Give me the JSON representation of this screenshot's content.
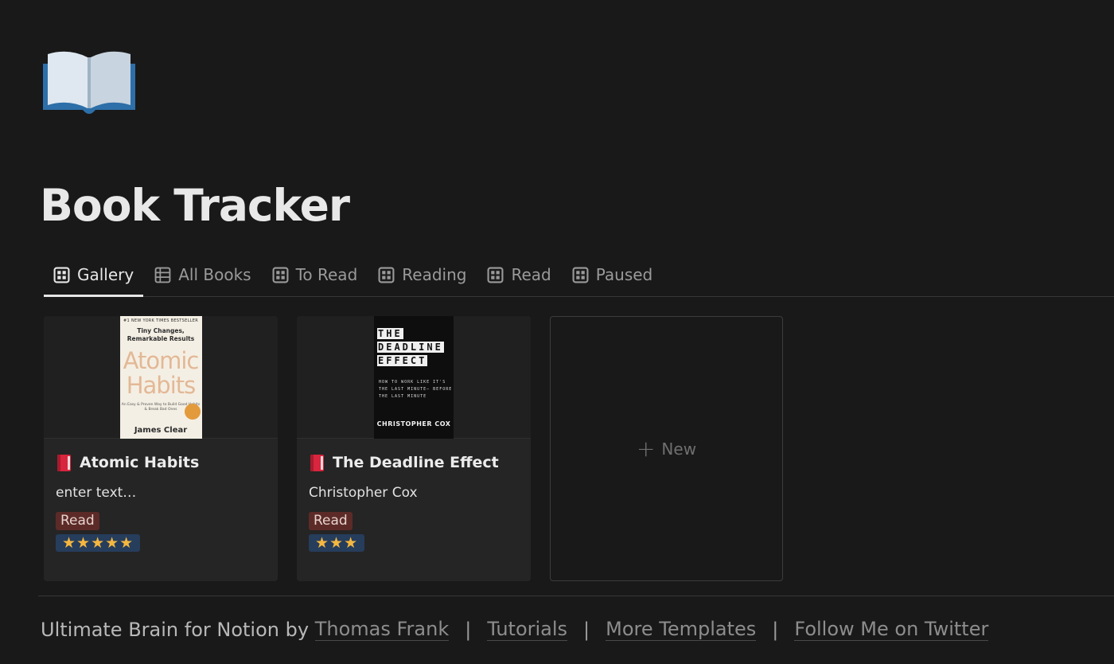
{
  "page": {
    "title": "Book Tracker",
    "icon": "open-book-icon"
  },
  "tabs": [
    {
      "label": "Gallery",
      "icon": "gallery-icon",
      "active": true
    },
    {
      "label": "All Books",
      "icon": "table-icon",
      "active": false
    },
    {
      "label": "To Read",
      "icon": "gallery-icon",
      "active": false
    },
    {
      "label": "Reading",
      "icon": "gallery-icon",
      "active": false
    },
    {
      "label": "Read",
      "icon": "gallery-icon",
      "active": false
    },
    {
      "label": "Paused",
      "icon": "gallery-icon",
      "active": false
    }
  ],
  "cards": [
    {
      "title": "Atomic Habits",
      "author": "enter text…",
      "status": "Read",
      "rating": "★★★★★",
      "cover": {
        "banner": "#1 NEW YORK TIMES BESTSELLER",
        "subtitle": "Tiny Changes, Remarkable Results",
        "title": "Atomic Habits",
        "description": "An Easy & Proven Way to Build Good Habits & Break Bad Ones",
        "author": "James Clear"
      }
    },
    {
      "title": "The Deadline Effect",
      "author": "Christopher Cox",
      "status": "Read",
      "rating": "★★★",
      "cover": {
        "title_line1": "THE",
        "title_line2": "DEADLINE",
        "title_line3": "EFFECT",
        "description": "HOW TO WORK LIKE IT'S THE LAST MINUTE— BEFORE THE LAST MINUTE",
        "author": "CHRISTOPHER COX"
      }
    }
  ],
  "new_card": {
    "label": "New"
  },
  "footer": {
    "prefix": "Ultimate Brain for Notion by",
    "author_link": "Thomas Frank",
    "separator": "|",
    "links": [
      "Tutorials",
      "More Templates",
      "Follow Me on Twitter"
    ]
  },
  "colors": {
    "background": "#191919",
    "card": "#252525",
    "status_tag": "#5c2b28",
    "rating_tag": "#263d5c",
    "star": "#f5b740"
  }
}
